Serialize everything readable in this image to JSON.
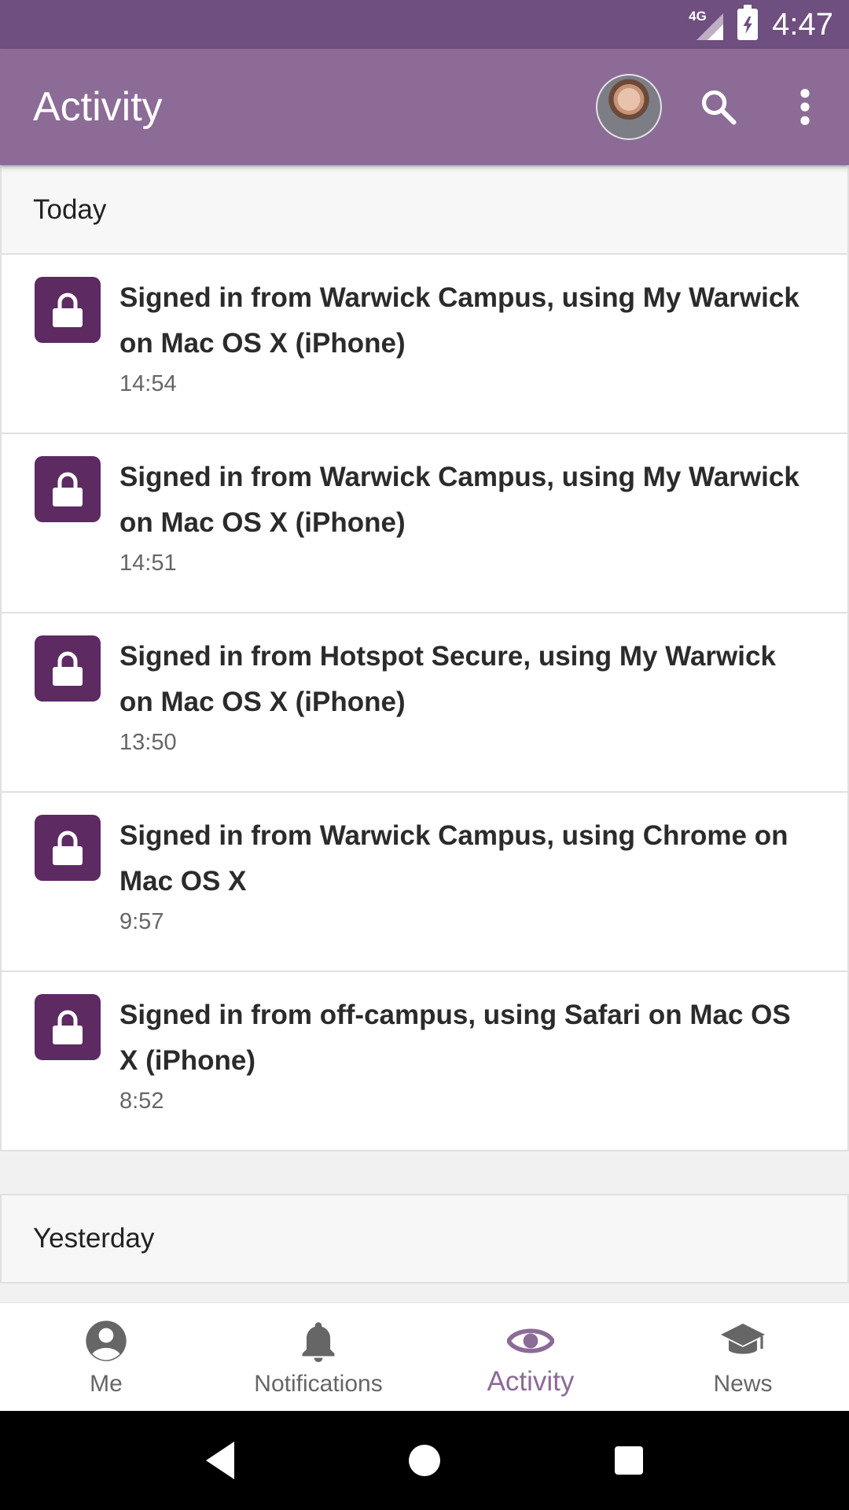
{
  "status_bar": {
    "network": "4G",
    "time": "4:47"
  },
  "app_bar": {
    "title": "Activity",
    "icons": [
      "avatar",
      "search-icon",
      "more-vert-icon"
    ]
  },
  "sections": [
    {
      "header": "Today",
      "items": [
        {
          "text": "Signed in from Warwick Campus, using My Warwick on Mac OS X (iPhone)",
          "time": "14:54",
          "icon": "lock-icon"
        },
        {
          "text": "Signed in from Warwick Campus, using My Warwick on Mac OS X (iPhone)",
          "time": "14:51",
          "icon": "lock-icon"
        },
        {
          "text": "Signed in from Hotspot Secure, using My Warwick on Mac OS X (iPhone)",
          "time": "13:50",
          "icon": "lock-icon"
        },
        {
          "text": "Signed in from Warwick Campus, using Chrome on Mac OS X",
          "time": "9:57",
          "icon": "lock-icon"
        },
        {
          "text": "Signed in from off-campus, using Safari on Mac OS X (iPhone)",
          "time": "8:52",
          "icon": "lock-icon"
        }
      ]
    },
    {
      "header": "Yesterday",
      "items": []
    }
  ],
  "bottom_nav": {
    "items": [
      {
        "label": "Me",
        "icon": "account-circle-icon",
        "active": false
      },
      {
        "label": "Notifications",
        "icon": "bell-icon",
        "active": false
      },
      {
        "label": "Activity",
        "icon": "eye-icon",
        "active": true
      },
      {
        "label": "News",
        "icon": "graduation-cap-icon",
        "active": false
      }
    ]
  },
  "colors": {
    "status_bar": "#6f4f7f",
    "app_bar": "#8c6b96",
    "accent": "#8c6b96",
    "icon_tile": "#5d2a62"
  }
}
